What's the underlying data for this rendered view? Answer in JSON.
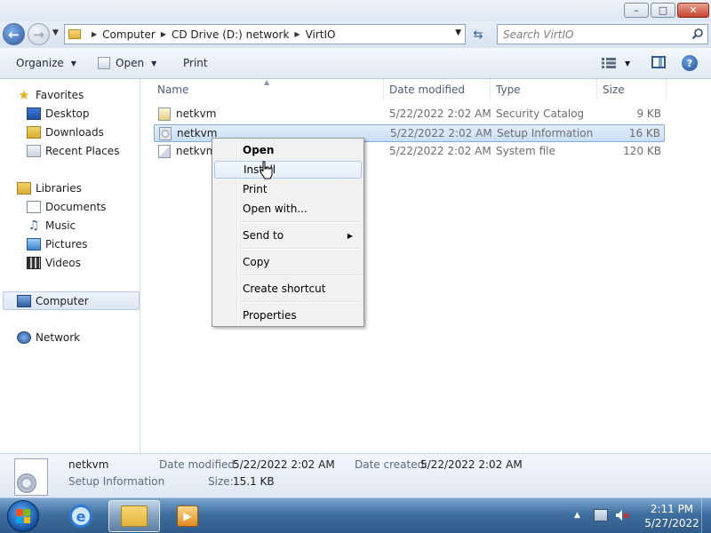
{
  "window": {
    "minimize_label": "–",
    "maximize_label": "□",
    "close_label": "✕"
  },
  "address": {
    "breadcrumbs": [
      "Computer",
      "CD Drive (D:) network",
      "VirtIO"
    ],
    "search_placeholder": "Search VirtIO"
  },
  "toolbar": {
    "organize_label": "Organize",
    "open_label": "Open",
    "print_label": "Print"
  },
  "sidebar": {
    "favorites": "Favorites",
    "favorites_items": [
      "Desktop",
      "Downloads",
      "Recent Places"
    ],
    "libraries": "Libraries",
    "libraries_items": [
      "Documents",
      "Music",
      "Pictures",
      "Videos"
    ],
    "computer": "Computer",
    "network": "Network"
  },
  "columns": {
    "name": "Name",
    "date": "Date modified",
    "type": "Type",
    "size": "Size"
  },
  "files": [
    {
      "name": "netkvm",
      "date": "5/22/2022 2:02 AM",
      "type": "Security Catalog",
      "size": "9 KB",
      "icon": "catalog-icon"
    },
    {
      "name": "netkvm",
      "date": "5/22/2022 2:02 AM",
      "type": "Setup Information",
      "size": "16 KB",
      "icon": "setup-information-icon",
      "selected": true
    },
    {
      "name": "netkvm",
      "date": "5/22/2022 2:02 AM",
      "type": "System file",
      "size": "120 KB",
      "icon": "system-file-icon"
    }
  ],
  "context_menu": {
    "open": "Open",
    "install": "Install",
    "print": "Print",
    "open_with": "Open with...",
    "send_to": "Send to",
    "copy": "Copy",
    "create_shortcut": "Create shortcut",
    "properties": "Properties"
  },
  "details": {
    "name": "netkvm",
    "type": "Setup Information",
    "date_modified_label": "Date modified:",
    "date_modified": "5/22/2022 2:02 AM",
    "date_created_label": "Date created:",
    "date_created": "5/22/2022 2:02 AM",
    "size_label": "Size:",
    "size": "15.1 KB"
  },
  "taskbar": {
    "time": "2:11 PM",
    "date": "5/27/2022"
  },
  "colors": {
    "selection": "#cce0f7",
    "taskbar": "#3f6f9f",
    "accent": "#2c5aa2"
  }
}
